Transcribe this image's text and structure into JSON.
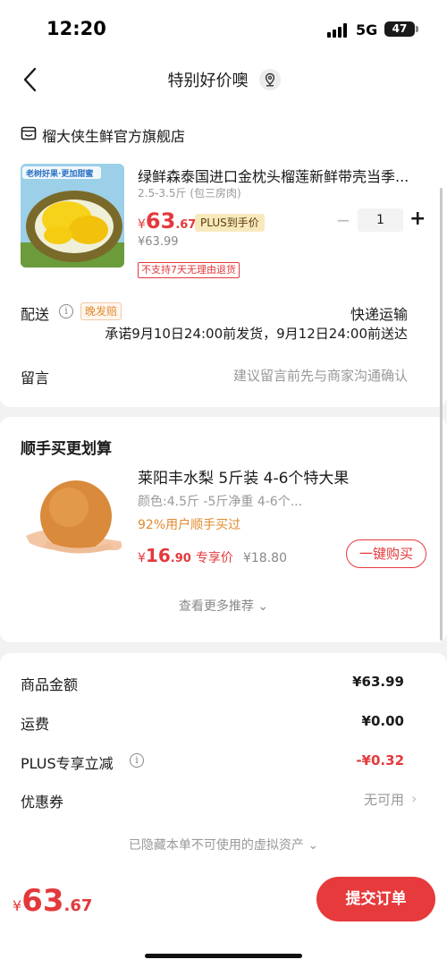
{
  "status_bar": {
    "time": "12:20",
    "network": "5G",
    "battery": "47"
  },
  "nav": {
    "title": "特别好价噢",
    "icons": [
      "back-icon",
      "location-icon"
    ]
  },
  "shop": {
    "name": "榴大侠生鲜官方旗舰店",
    "icon": "shop-icon"
  },
  "product": {
    "title": "绿鲜森泰国进口金枕头榴莲新鲜带壳当季...",
    "spec": "2.5-3.5斤 (包三房肉)",
    "price_symbol": "¥",
    "price_int": "63",
    "price_dec": ".67",
    "plus_tag": "PLUS到手价",
    "original_price": "¥63.99",
    "no_return": "不支持7天无理由退货",
    "quantity": "1",
    "image_text": "老树好果·更加甜蜜"
  },
  "delivery": {
    "label": "配送",
    "late_tag": "晚发赔",
    "method": "快递运输",
    "promise": "承诺9月10日24:00前发货，9月12日24:00前送达"
  },
  "message": {
    "label": "留言",
    "placeholder": "建议留言前先与商家沟通确认"
  },
  "recommend": {
    "title": "顺手买更划算",
    "name": "莱阳丰水梨 5斤装 4-6个特大果",
    "spec": "颜色:4.5斤 -5斤净重 4-6个...",
    "percent": "92%用户顺手买过",
    "price_symbol": "¥",
    "price_int": "16",
    "price_dec": ".90",
    "price_tag": "专享价",
    "original_price": "¥18.80",
    "buy_button": "一键购买",
    "more": "查看更多推荐 ⌄"
  },
  "summary": {
    "goods_label": "商品金额",
    "goods_value": "¥63.99",
    "shipping_label": "运费",
    "shipping_value": "¥0.00",
    "plus_label": "PLUS专享立减",
    "plus_value": "-¥0.32",
    "coupon_label": "优惠券",
    "coupon_value": "无可用",
    "hidden_assets": "已隐藏本单不可使用的虚拟资产 ⌄"
  },
  "bottom": {
    "price_symbol": "¥",
    "price_int": "63",
    "price_dec": ".67",
    "submit": "提交订单"
  },
  "colors": {
    "accent": "#e4393c",
    "plus_gold": "#f8e9bd",
    "orange": "#e08b30"
  }
}
